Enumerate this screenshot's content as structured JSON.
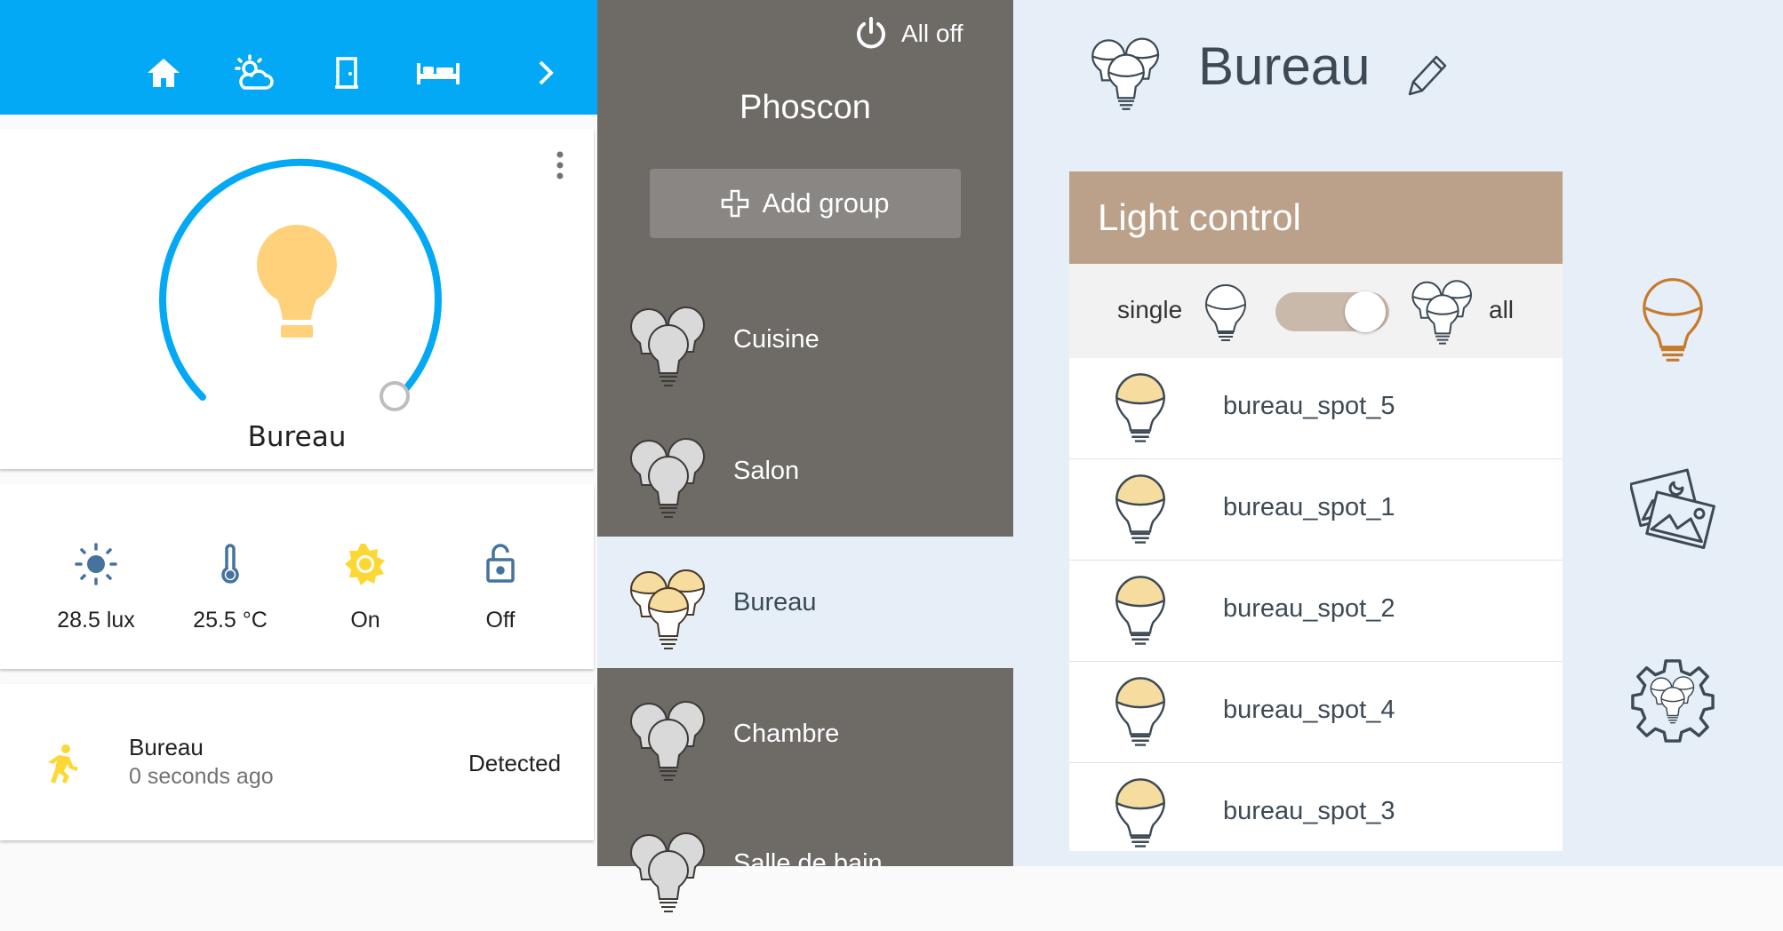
{
  "home_assistant": {
    "tabs": [
      {
        "icon": "home-icon"
      },
      {
        "icon": "weather-partly-cloudy-icon"
      },
      {
        "icon": "door-icon"
      },
      {
        "icon": "bed-icon"
      },
      {
        "icon": "chevron-right-icon"
      }
    ],
    "light_card": {
      "name": "Bureau",
      "brightness_percent": 100,
      "icon": "lightbulb-icon",
      "menu_icon": "dots-vertical-icon",
      "bulb_color": "#ffd17a"
    },
    "sensors": [
      {
        "icon": "brightness-icon",
        "value": "28.5 lux"
      },
      {
        "icon": "thermometer-icon",
        "value": "25.5 °C"
      },
      {
        "icon": "sun-icon",
        "value": "On"
      },
      {
        "icon": "lock-open-icon",
        "value": "Off"
      }
    ],
    "motion": {
      "icon": "motion-sensor-icon",
      "name": "Bureau",
      "time": "0 seconds ago",
      "state": "Detected"
    },
    "colors": {
      "accent": "#03a9f4",
      "icon_blue": "#44739e",
      "sun_yellow": "#fdd835"
    }
  },
  "phoscon_sidebar": {
    "all_off_label": "All off",
    "title": "Phoscon",
    "add_group_label": "Add group",
    "groups": [
      {
        "label": "Cuisine",
        "active": false
      },
      {
        "label": "Salon",
        "active": false
      },
      {
        "label": "Bureau",
        "active": true
      },
      {
        "label": "Chambre",
        "active": false
      },
      {
        "label": "Salle de bain",
        "active": false
      }
    ]
  },
  "phoscon_main": {
    "group_title": "Bureau",
    "light_control": {
      "title": "Light control",
      "single_label": "single",
      "all_label": "all",
      "toggle_on": true,
      "lights": [
        "bureau_spot_5",
        "bureau_spot_1",
        "bureau_spot_2",
        "bureau_spot_4",
        "bureau_spot_3"
      ]
    },
    "side_tools": [
      {
        "icon": "lightbulb-outline-icon"
      },
      {
        "icon": "scenes-icon"
      },
      {
        "icon": "group-settings-icon"
      }
    ],
    "colors": {
      "header": "#bba18a",
      "background": "#e6eff7",
      "sidebar": "#6e6a66"
    }
  }
}
